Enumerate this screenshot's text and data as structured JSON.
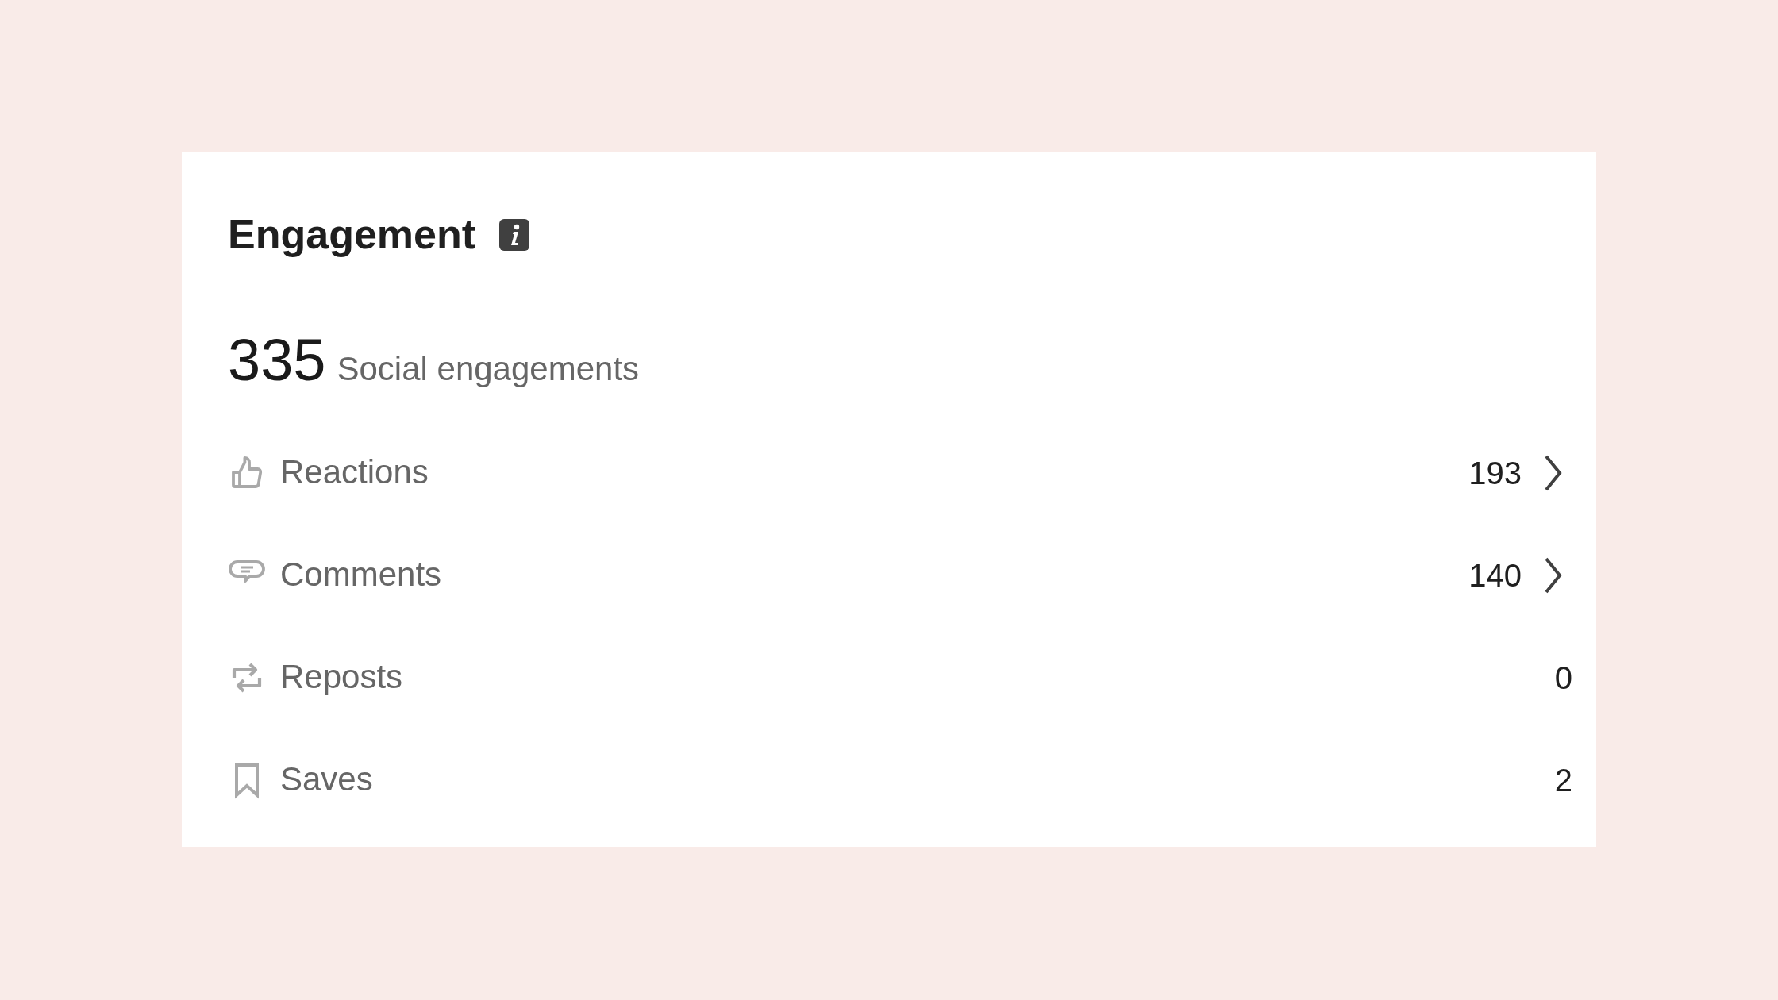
{
  "card": {
    "title": "Engagement",
    "total": {
      "value": "335",
      "label": "Social engagements"
    },
    "metrics": [
      {
        "label": "Reactions",
        "value": "193",
        "kind": "link"
      },
      {
        "label": "Comments",
        "value": "140",
        "kind": "link"
      },
      {
        "label": "Reposts",
        "value": "0",
        "kind": "plain"
      },
      {
        "label": "Saves",
        "value": "2",
        "kind": "plain"
      }
    ]
  }
}
